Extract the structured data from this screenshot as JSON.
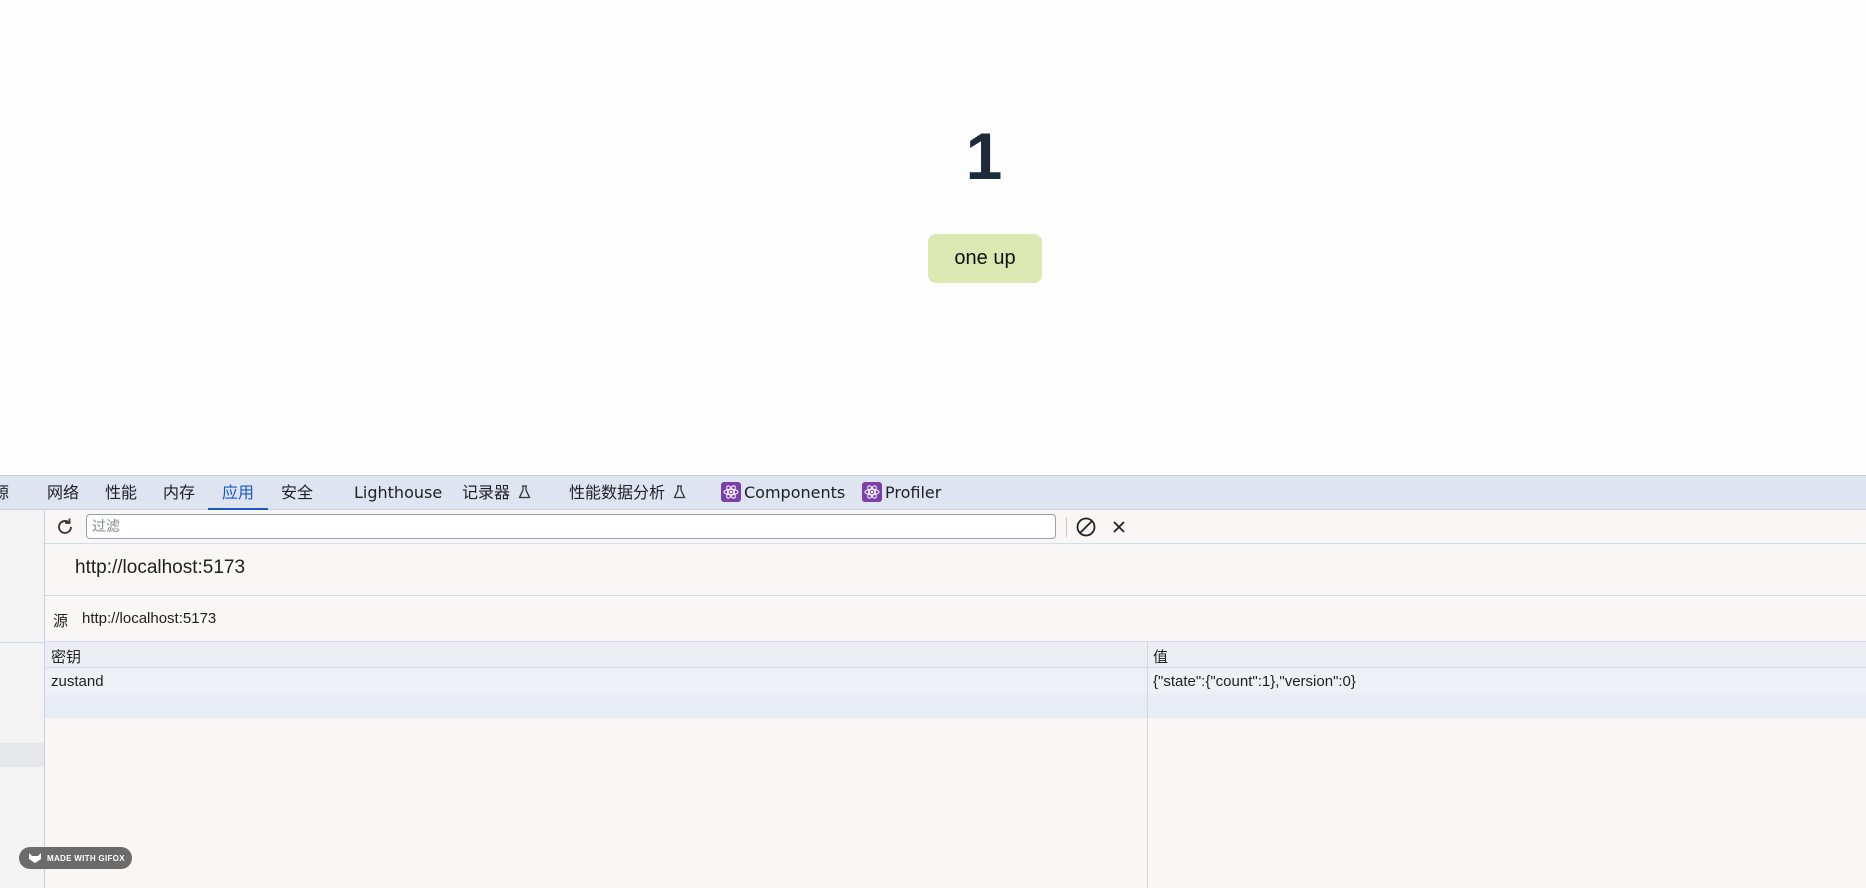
{
  "page": {
    "count": "1",
    "button_label": "one up"
  },
  "devtools": {
    "tabs": [
      {
        "label": "资源",
        "visible_part": "源"
      },
      {
        "label": "网络"
      },
      {
        "label": "性能"
      },
      {
        "label": "内存"
      },
      {
        "label": "应用",
        "active": true
      },
      {
        "label": "安全"
      },
      {
        "label": "Lighthouse"
      },
      {
        "label": "记录器",
        "flask": "⚗"
      },
      {
        "label": "性能数据分析",
        "flask": "⚗"
      },
      {
        "label": "Components",
        "icon": "react-icon"
      },
      {
        "label": "Profiler",
        "icon": "react-icon"
      }
    ],
    "toolbar": {
      "filter_placeholder": "过滤"
    },
    "storage": {
      "origin_title": "http://localhost:5173",
      "origin_label": "源",
      "origin_value": "http://localhost:5173"
    },
    "table": {
      "columns": [
        "密钥",
        "值"
      ],
      "rows": [
        {
          "key": "zustand",
          "value": "{\"state\":{\"count\":1},\"version\":0}"
        }
      ]
    }
  },
  "watermark": {
    "text": "MADE WITH GIFOX"
  },
  "colors": {
    "accent": "#1a57c7",
    "button_bg": "#dce8b1",
    "count_text": "#1e2a3a",
    "tabbar_bg": "#dfe4f1"
  }
}
